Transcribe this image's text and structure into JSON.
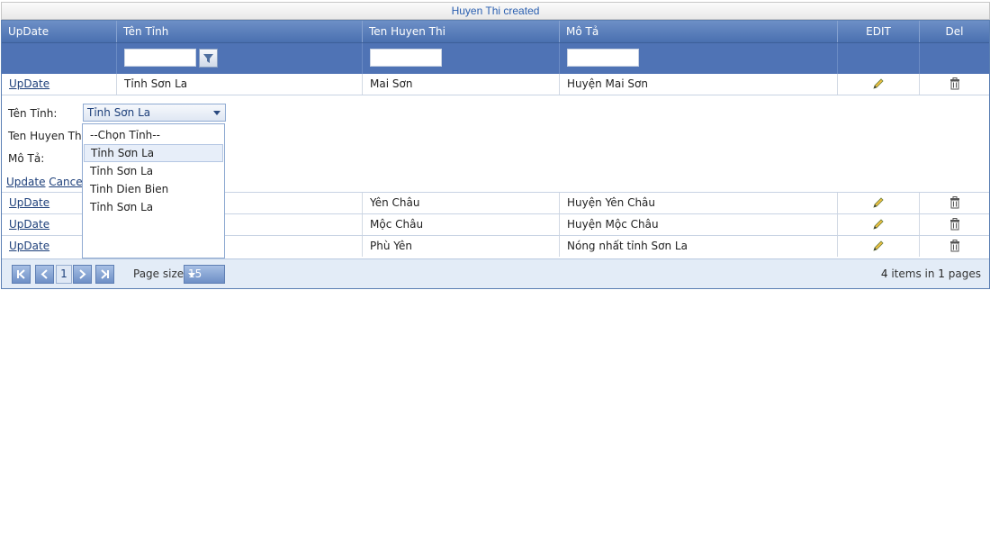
{
  "status_message": "Huyen Thi created",
  "columns": {
    "update": "UpDate",
    "tinh": "Tên Tỉnh",
    "huyen": "Ten Huyen Thi",
    "mota": "Mô Tả",
    "edit": "EDIT",
    "del": "Del"
  },
  "rows": [
    {
      "update": "UpDate",
      "tinh": "Tỉnh Sơn La",
      "huyen": "Mai Sơn",
      "mota": "Huyện Mai Sơn"
    },
    {
      "update": "UpDate",
      "tinh": "",
      "huyen": "Yên Châu",
      "mota": "Huyện Yên Châu"
    },
    {
      "update": "UpDate",
      "tinh": "",
      "huyen": "Mộc Châu",
      "mota": "Huyện Mộc Châu"
    },
    {
      "update": "UpDate",
      "tinh": "",
      "huyen": "Phù Yên",
      "mota": "Nóng nhất tỉnh Sơn La"
    }
  ],
  "edit_form": {
    "tinh_label": "Tên Tỉnh:",
    "huyen_label": "Ten Huyen Thi:",
    "mota_label": "Mô Tả:",
    "selected_tinh": "Tỉnh Sơn La",
    "update_link": "Update",
    "cancel_link": "Cancel"
  },
  "dropdown_options": [
    "--Chọn Tỉnh--",
    "Tỉnh Sơn La",
    "Tỉnh Sơn La",
    "Tinh Dien Bien",
    "Tỉnh Sơn La"
  ],
  "dropdown_selected_index": 1,
  "pager": {
    "current_page": "1",
    "page_size_label": "Page size:",
    "page_size": "15",
    "items_count": "4",
    "items_mid": "items in",
    "pages_count": "1",
    "pages_suffix": "pages"
  },
  "icons": {
    "edit": "pencil-icon",
    "delete": "trash-icon",
    "filter": "filter-icon"
  },
  "colors": {
    "header": "#4a70b0",
    "filter_row": "#4f73b5",
    "pager_bg": "#e3ecf7",
    "link": "#1d3f7a"
  }
}
